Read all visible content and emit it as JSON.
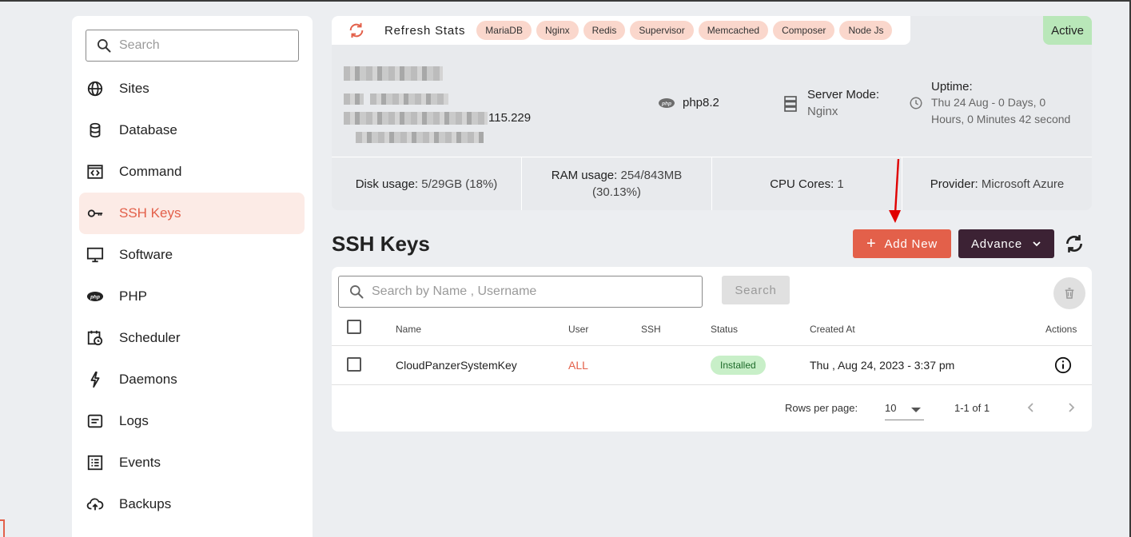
{
  "sidebar": {
    "search_placeholder": "Search",
    "items": [
      {
        "label": "Sites",
        "icon": "globe-icon"
      },
      {
        "label": "Database",
        "icon": "database-icon"
      },
      {
        "label": "Command",
        "icon": "code-window-icon"
      },
      {
        "label": "SSH Keys",
        "icon": "key-icon",
        "active": true
      },
      {
        "label": "Software",
        "icon": "monitor-icon"
      },
      {
        "label": "PHP",
        "icon": "php-icon"
      },
      {
        "label": "Scheduler",
        "icon": "calendar-clock-icon"
      },
      {
        "label": "Daemons",
        "icon": "lightning-icon"
      },
      {
        "label": "Logs",
        "icon": "log-icon"
      },
      {
        "label": "Events",
        "icon": "list-icon"
      },
      {
        "label": "Backups",
        "icon": "cloud-upload-icon"
      }
    ]
  },
  "stats": {
    "refresh_label": "Refresh Stats",
    "services": [
      "MariaDB",
      "Nginx",
      "Redis",
      "Supervisor",
      "Memcached",
      "Composer",
      "Node Js"
    ],
    "status": "Active",
    "ip_suffix": "115.229",
    "php_version": "php8.2",
    "server_mode_label": "Server Mode:",
    "server_mode_value": "Nginx",
    "uptime_label": "Uptime:",
    "uptime_value": "Thu 24 Aug - 0 Days, 0 Hours, 0 Minutes 42 second",
    "disk_label": "Disk usage:",
    "disk_value": "5/29GB (18%)",
    "ram_label": "RAM usage:",
    "ram_value_1": "254/843MB",
    "ram_value_2": "(30.13%)",
    "cpu_label": "CPU Cores:",
    "cpu_value": "1",
    "provider_label": "Provider:",
    "provider_value": "Microsoft Azure"
  },
  "main": {
    "title": "SSH Keys",
    "add_button": "Add New",
    "advance_button": "Advance",
    "search_placeholder": "Search by Name , Username",
    "search_button": "Search",
    "columns": [
      "Name",
      "User",
      "SSH",
      "Status",
      "Created At",
      "Actions"
    ],
    "rows": [
      {
        "name": "CloudPanzerSystemKey",
        "user": "ALL",
        "ssh": "",
        "status": "Installed",
        "created_at": "Thu , Aug 24, 2023 - 3:37 pm"
      }
    ],
    "rows_per_page_label": "Rows per page:",
    "rows_per_page": "10",
    "range": "1-1 of 1"
  },
  "colors": {
    "accent": "#e3604a",
    "dark": "#3c2234",
    "active_green": "#b9e7b9"
  }
}
